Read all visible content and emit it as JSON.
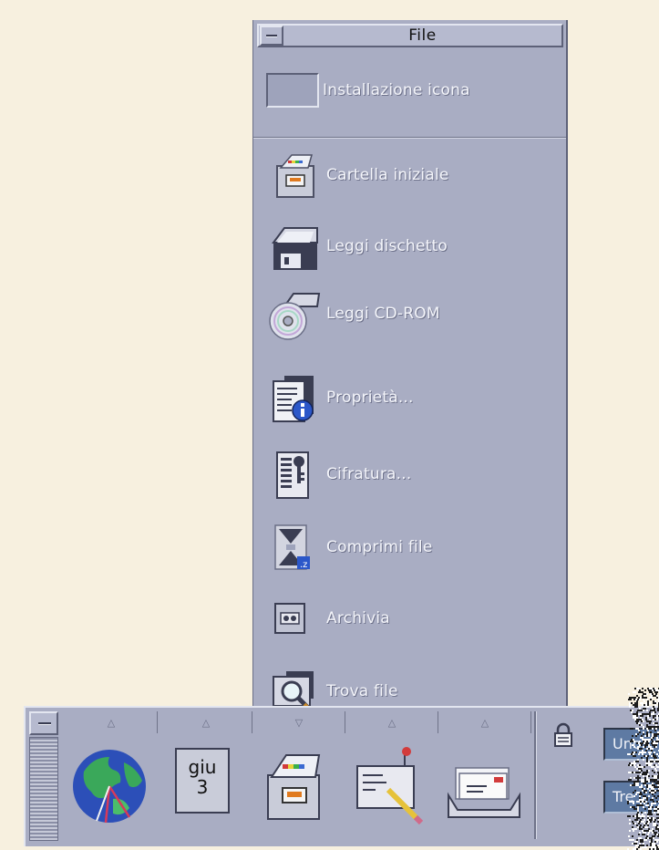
{
  "subpanel": {
    "title": "File",
    "install_label": "Installazione icona",
    "items": [
      {
        "label": "Cartella iniziale",
        "icon": "home-folder-icon"
      },
      {
        "label": "Leggi dischetto",
        "icon": "floppy-disk-icon"
      },
      {
        "label": "Leggi CD-ROM",
        "icon": "cd-rom-icon"
      },
      {
        "label": "Proprietà...",
        "icon": "properties-info-icon"
      },
      {
        "label": "Cifratura...",
        "icon": "encryption-key-icon"
      },
      {
        "label": "Comprimi file",
        "icon": "compress-file-icon"
      },
      {
        "label": "Archivia",
        "icon": "archive-tape-icon"
      },
      {
        "label": "Trova file",
        "icon": "find-file-magnifier-icon"
      }
    ]
  },
  "frontpanel": {
    "arrows": [
      "up",
      "up",
      "down",
      "up",
      "up"
    ],
    "icons": [
      "world-clock-icon",
      "calendar-icon",
      "file-manager-icon",
      "text-editor-icon",
      "mailer-icon"
    ],
    "calendar": {
      "month": "giu",
      "day": "3"
    },
    "workspaces": [
      "Uno",
      "Tre"
    ]
  },
  "colors": {
    "panel": "#a9adc3",
    "desktop": "#f7f0df",
    "workspace_button": "#5e7aa3"
  }
}
